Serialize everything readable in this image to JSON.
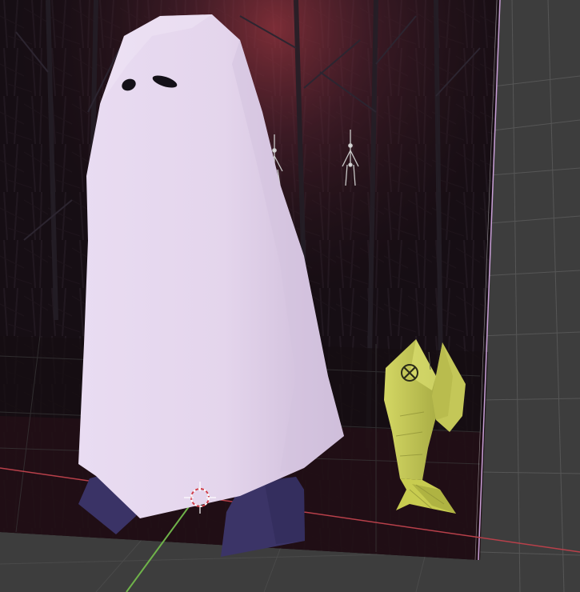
{
  "app": {
    "view": "3D viewport"
  },
  "colors": {
    "viewport_floor": "#3d3d3d",
    "backdrop_dark": "#0c0a0d",
    "backdrop_tint": "#3a1e2c",
    "sky_glow": "#c4444e",
    "ghost_body": "#e5d7ee",
    "ghost_shadow": "#cdbcd8",
    "ghost_feet": "#3a3366",
    "fish_body": "#c6c85a",
    "fish_dark": "#9fa33e",
    "axis_x_red": "#b8404a",
    "axis_y_green": "#6fb34a",
    "plane_edge": "#c9a0d8",
    "grid_line": "#5a5a5a",
    "armature": "#c8c8c8"
  },
  "objects": [
    {
      "name": "ghost",
      "icon": "ghost-mesh"
    },
    {
      "name": "fish",
      "icon": "fish-mesh"
    },
    {
      "name": "armature-left",
      "icon": "armature-bones"
    },
    {
      "name": "armature-right",
      "icon": "armature-bones"
    },
    {
      "name": "3d-cursor",
      "icon": "crosshair-cursor"
    }
  ]
}
